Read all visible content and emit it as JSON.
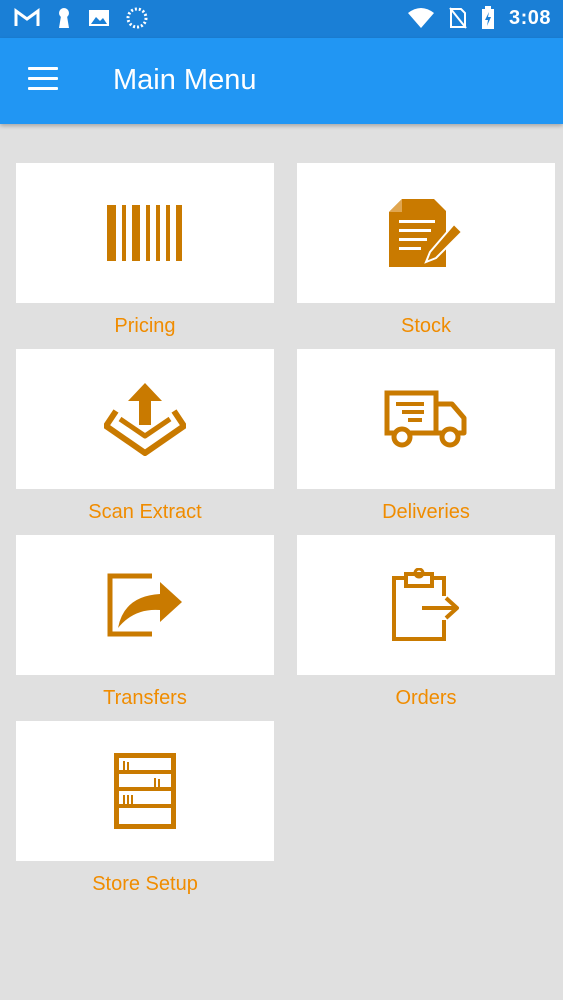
{
  "status_bar": {
    "time": "3:08",
    "icons": [
      "gmail-icon",
      "keyhole-icon",
      "image-icon",
      "sync-icon",
      "wifi-icon",
      "no-sim-icon",
      "battery-charging-icon"
    ]
  },
  "app_bar": {
    "title": "Main Menu",
    "menu_icon": "hamburger-menu-icon"
  },
  "colors": {
    "status_bar": "#1a7fd6",
    "app_bar": "#2196f3",
    "accent": "#f08c00",
    "icon": "#c97a00",
    "background": "#e0e0e0"
  },
  "menu": {
    "items": [
      {
        "label": "Pricing",
        "icon": "barcode-icon"
      },
      {
        "label": "Stock",
        "icon": "document-edit-icon"
      },
      {
        "label": "Scan Extract",
        "icon": "box-upload-icon"
      },
      {
        "label": "Deliveries",
        "icon": "delivery-truck-icon"
      },
      {
        "label": "Transfers",
        "icon": "share-arrow-icon"
      },
      {
        "label": "Orders",
        "icon": "clipboard-arrow-icon"
      },
      {
        "label": "Store Setup",
        "icon": "bookshelf-icon"
      }
    ]
  }
}
